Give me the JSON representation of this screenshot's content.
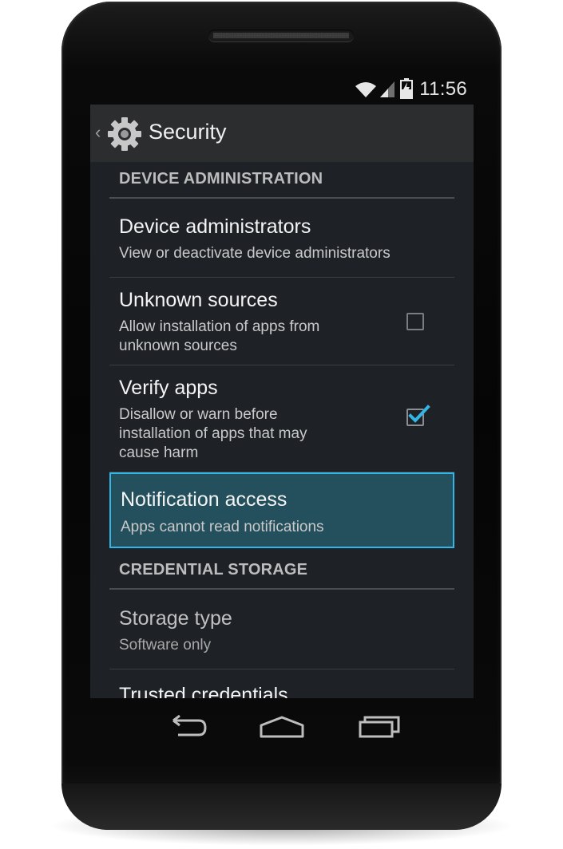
{
  "status_bar": {
    "time": "11:56",
    "icons": [
      "wifi-icon",
      "cell-signal-icon",
      "battery-charging-icon"
    ]
  },
  "action_bar": {
    "icon": "gear-icon",
    "title": "Security"
  },
  "sections": [
    {
      "header": "DEVICE ADMINISTRATION",
      "items": [
        {
          "title": "Device administrators",
          "summary": "View or deactivate device administrators"
        },
        {
          "title": "Unknown sources",
          "summary_lines": [
            "Allow installation of apps from",
            "unknown sources"
          ],
          "checked": false
        },
        {
          "title": "Verify apps",
          "summary_lines": [
            "Disallow or warn before",
            "installation of apps that may",
            "cause harm"
          ],
          "checked": true
        },
        {
          "title": "Notification access",
          "summary": "Apps cannot read notifications",
          "selected": true
        }
      ]
    },
    {
      "header": "CREDENTIAL STORAGE",
      "items": [
        {
          "title": "Storage type",
          "summary": "Software only",
          "enabled": false
        },
        {
          "title": "Trusted credentials"
        }
      ]
    }
  ],
  "nav_bar": {
    "buttons": [
      "back-icon",
      "home-icon",
      "recent-apps-icon"
    ]
  },
  "colors": {
    "accent": "#33b5e5",
    "selected_background": "#24505e",
    "screen_background": "#1e2126",
    "action_bar_background": "#2b2d2f"
  }
}
